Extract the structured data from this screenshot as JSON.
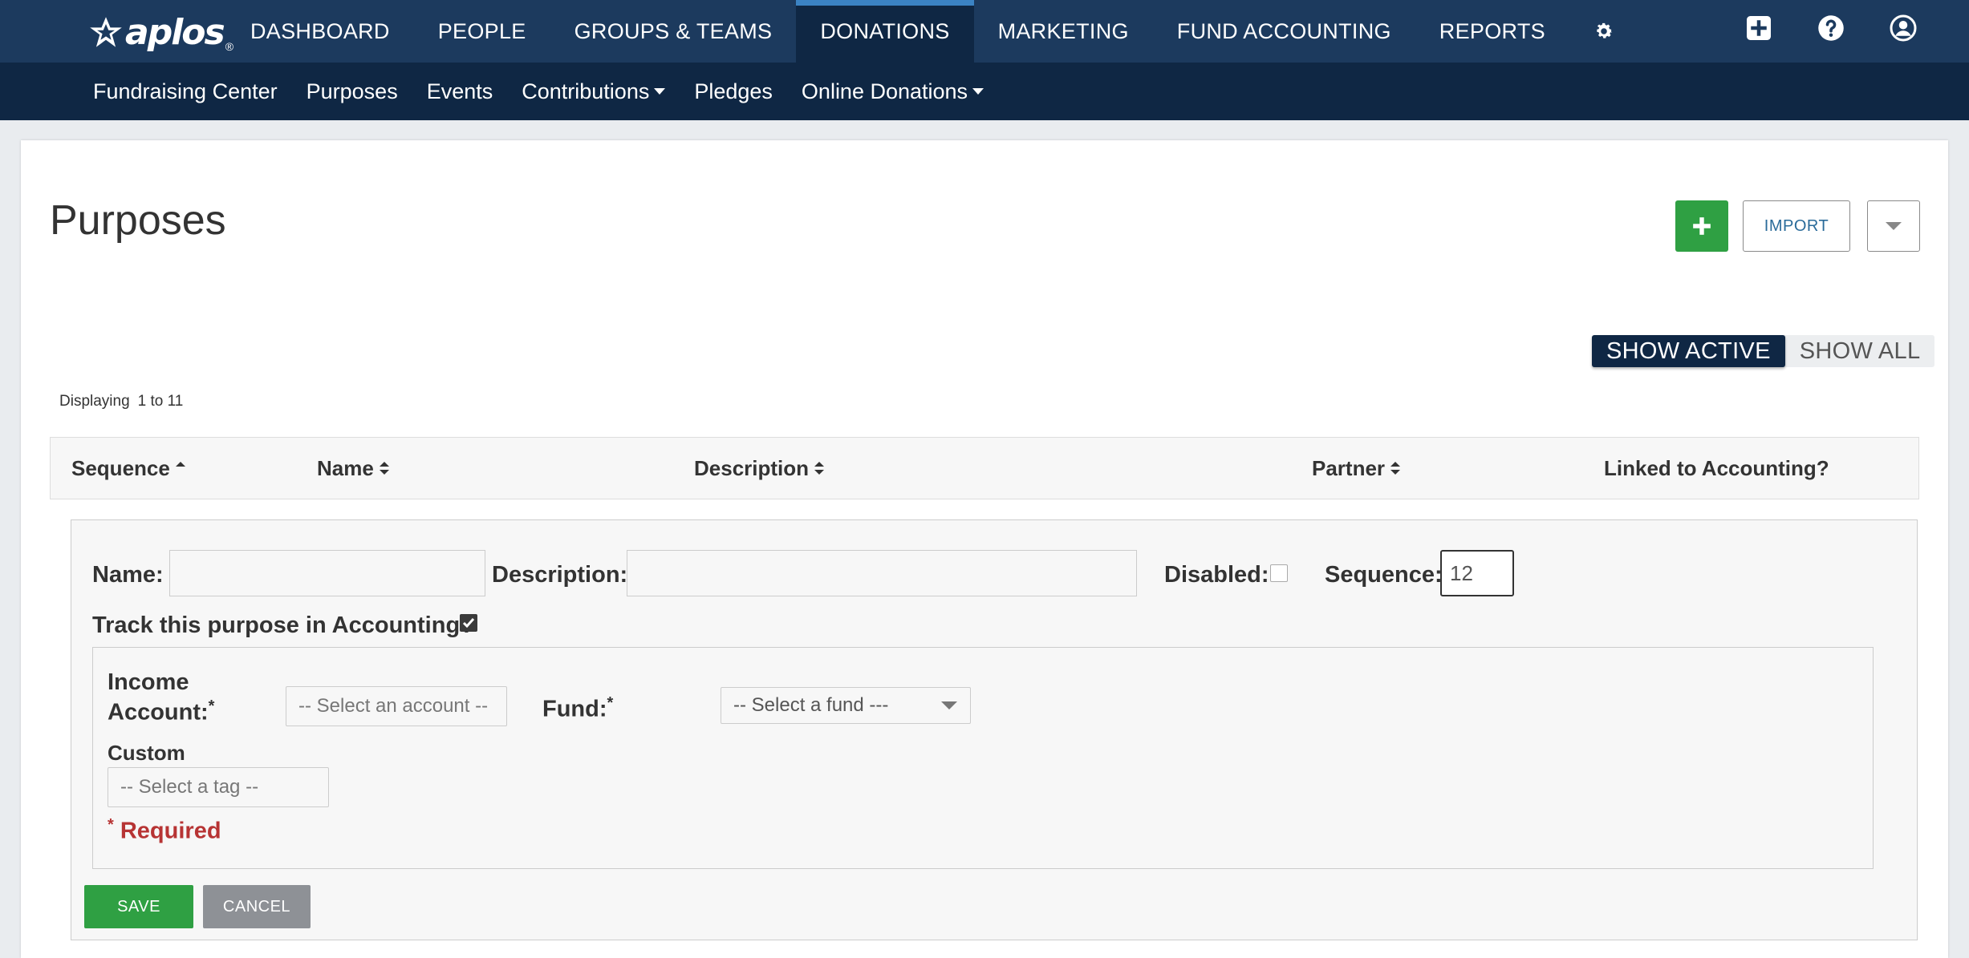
{
  "topnav": {
    "logo_text": "aplos",
    "logo_reg": "®",
    "items": [
      "DASHBOARD",
      "PEOPLE",
      "GROUPS & TEAMS",
      "DONATIONS",
      "MARKETING",
      "FUND ACCOUNTING",
      "REPORTS"
    ],
    "active_item": "DONATIONS"
  },
  "subnav": {
    "items": [
      "Fundraising Center",
      "Purposes",
      "Events",
      "Contributions",
      "Pledges",
      "Online Donations"
    ]
  },
  "page": {
    "title": "Purposes",
    "import_label": "IMPORT",
    "toggle": {
      "active": "SHOW ACTIVE",
      "all": "SHOW ALL"
    },
    "displaying_label": "Displaying",
    "displaying_range": "1 to 11"
  },
  "table": {
    "headers": [
      "Sequence",
      "Name",
      "Description",
      "Partner",
      "Linked to Accounting?"
    ]
  },
  "form": {
    "name_label": "Name:",
    "name_value": "",
    "description_label": "Description:",
    "description_value": "",
    "disabled_label": "Disabled:",
    "sequence_label": "Sequence:",
    "sequence_value": "12",
    "track_label": "Track this purpose in Accounting?",
    "income_label_1": "Income",
    "income_label_2": "Account:",
    "income_placeholder": "-- Select an account --",
    "fund_label": "Fund:",
    "fund_placeholder": "-- Select a fund ---",
    "custom_label": "Custom",
    "tag_placeholder": "-- Select a tag --",
    "required_star": "*",
    "required_label": "Required",
    "save_label": "SAVE",
    "cancel_label": "CANCEL"
  }
}
